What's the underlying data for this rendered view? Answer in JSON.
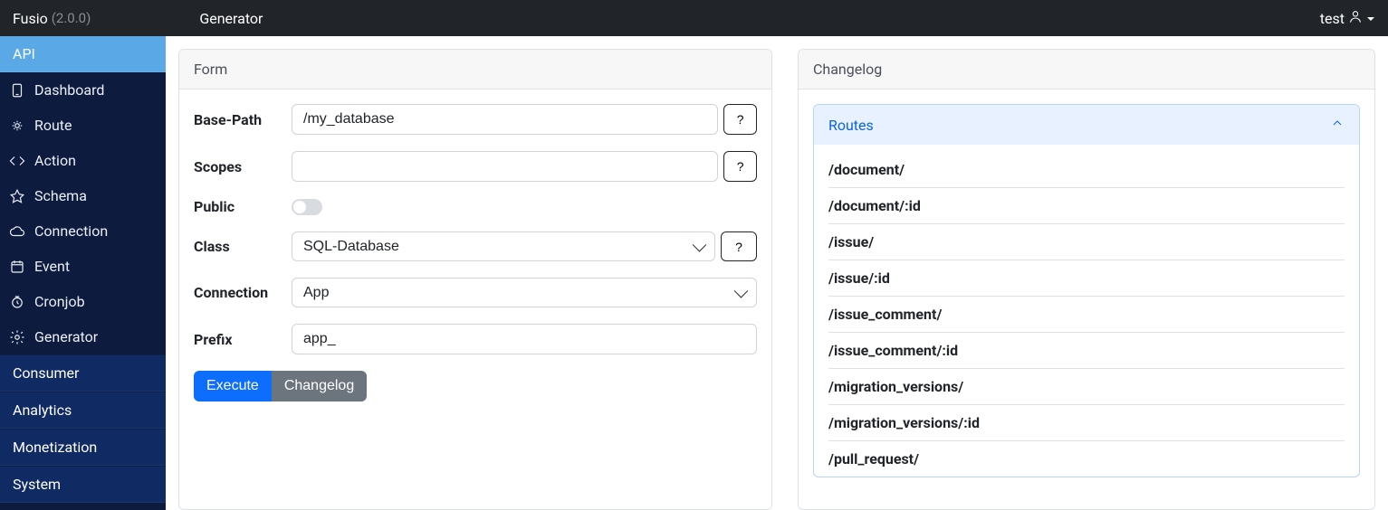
{
  "topbar": {
    "brand": "Fusio",
    "version": "(2.0.0)",
    "page_title": "Generator",
    "user": "test"
  },
  "sidebar": {
    "active_group": "API",
    "items": [
      {
        "icon": "dashboard",
        "label": "Dashboard"
      },
      {
        "icon": "route",
        "label": "Route"
      },
      {
        "icon": "action",
        "label": "Action"
      },
      {
        "icon": "schema",
        "label": "Schema"
      },
      {
        "icon": "connection",
        "label": "Connection"
      },
      {
        "icon": "event",
        "label": "Event"
      },
      {
        "icon": "cronjob",
        "label": "Cronjob"
      },
      {
        "icon": "generator",
        "label": "Generator"
      }
    ],
    "groups": [
      "Consumer",
      "Analytics",
      "Monetization",
      "System"
    ]
  },
  "form": {
    "title": "Form",
    "base_path_label": "Base-Path",
    "base_path_value": "/my_database",
    "scopes_label": "Scopes",
    "scopes_value": "",
    "public_label": "Public",
    "public_value": false,
    "class_label": "Class",
    "class_value": "SQL-Database",
    "connection_label": "Connection",
    "connection_value": "App",
    "prefix_label": "Prefix",
    "prefix_value": "app_",
    "help": "?",
    "execute_label": "Execute",
    "changelog_label": "Changelog"
  },
  "changelog": {
    "title": "Changelog",
    "accordion_title": "Routes",
    "routes": [
      "/document/",
      "/document/:id",
      "/issue/",
      "/issue/:id",
      "/issue_comment/",
      "/issue_comment/:id",
      "/migration_versions/",
      "/migration_versions/:id",
      "/pull_request/"
    ]
  }
}
